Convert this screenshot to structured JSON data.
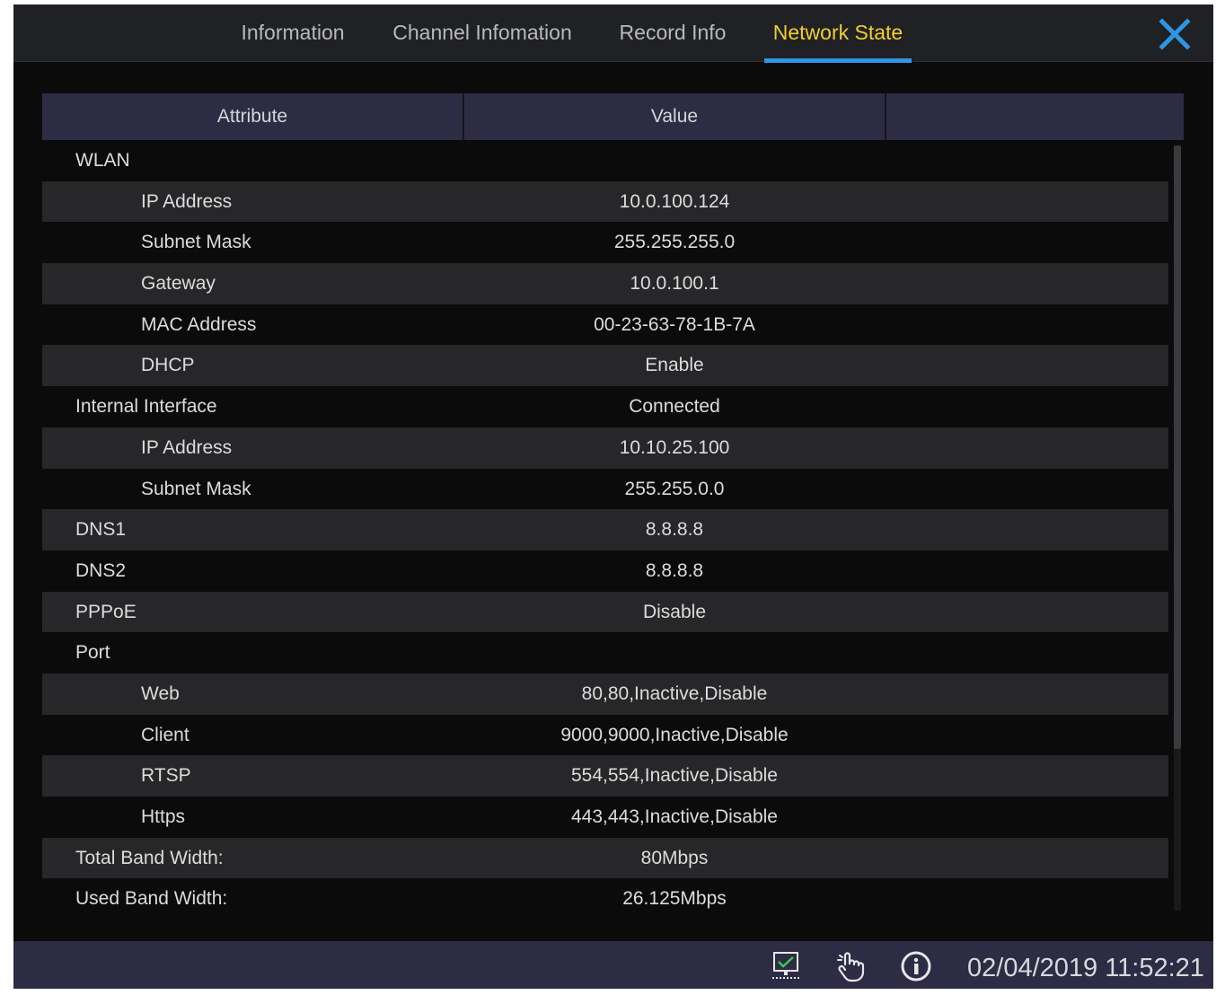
{
  "tabs": [
    {
      "label": "Information",
      "active": false
    },
    {
      "label": "Channel Infomation",
      "active": false
    },
    {
      "label": "Record Info",
      "active": false
    },
    {
      "label": "Network State",
      "active": true
    }
  ],
  "colors": {
    "active_tab_text": "#f2cf2c",
    "active_tab_underline": "#2f96e4",
    "close_icon": "#2f96e4",
    "header_bg": "#2d2c44",
    "row_alt_bg": "#27272a"
  },
  "close_icon": "close-x",
  "table": {
    "columns": [
      "Attribute",
      "Value",
      ""
    ],
    "rows": [
      {
        "attribute": "WLAN",
        "value": "",
        "level": 0
      },
      {
        "attribute": "IP Address",
        "value": "10.0.100.124",
        "level": 1
      },
      {
        "attribute": "Subnet Mask",
        "value": "255.255.255.0",
        "level": 1
      },
      {
        "attribute": "Gateway",
        "value": "10.0.100.1",
        "level": 1
      },
      {
        "attribute": "MAC Address",
        "value": "00-23-63-78-1B-7A",
        "level": 1
      },
      {
        "attribute": "DHCP",
        "value": "Enable",
        "level": 1
      },
      {
        "attribute": "Internal Interface",
        "value": "Connected",
        "level": 0
      },
      {
        "attribute": "IP Address",
        "value": "10.10.25.100",
        "level": 1
      },
      {
        "attribute": "Subnet Mask",
        "value": "255.255.0.0",
        "level": 1
      },
      {
        "attribute": "DNS1",
        "value": "8.8.8.8",
        "level": 0
      },
      {
        "attribute": "DNS2",
        "value": "8.8.8.8",
        "level": 0
      },
      {
        "attribute": "PPPoE",
        "value": "Disable",
        "level": 0
      },
      {
        "attribute": "Port",
        "value": "",
        "level": 0
      },
      {
        "attribute": "Web",
        "value": "80,80,Inactive,Disable",
        "level": 1
      },
      {
        "attribute": "Client",
        "value": "9000,9000,Inactive,Disable",
        "level": 1
      },
      {
        "attribute": "RTSP",
        "value": "554,554,Inactive,Disable",
        "level": 1
      },
      {
        "attribute": "Https",
        "value": "443,443,Inactive,Disable",
        "level": 1
      },
      {
        "attribute": "Total Band Width:",
        "value": "80Mbps",
        "level": 0
      },
      {
        "attribute": "Used Band Width:",
        "value": "26.125Mbps",
        "level": 0
      }
    ]
  },
  "statusbar": {
    "icons": [
      "network-monitor-icon",
      "hand-pointer-icon",
      "info-icon"
    ],
    "datetime": "02/04/2019 11:52:21"
  }
}
